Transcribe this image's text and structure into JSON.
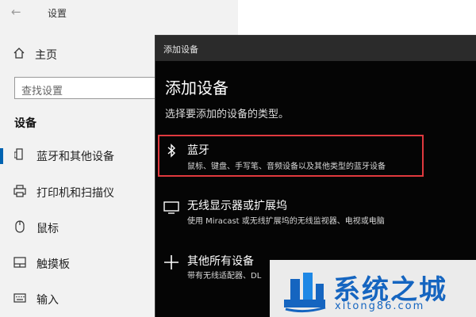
{
  "settings": {
    "title": "设置",
    "back_icon": "back-arrow-icon",
    "home_label": "主页",
    "search_placeholder": "查找设置",
    "section_title": "设备",
    "nav": [
      {
        "label": "蓝牙和其他设备",
        "icon": "bluetooth-devices-icon",
        "selected": true
      },
      {
        "label": "打印机和扫描仪",
        "icon": "printer-icon",
        "selected": false
      },
      {
        "label": "鼠标",
        "icon": "mouse-icon",
        "selected": false
      },
      {
        "label": "触摸板",
        "icon": "touchpad-icon",
        "selected": false
      },
      {
        "label": "输入",
        "icon": "keyboard-icon",
        "selected": false
      }
    ]
  },
  "dialog": {
    "window_title": "添加设备",
    "heading": "添加设备",
    "subtitle": "选择要添加的设备的类型。",
    "options": [
      {
        "name": "蓝牙",
        "desc": "鼠标、键盘、手写笔、音频设备以及其他类型的蓝牙设备",
        "icon": "bluetooth-icon",
        "highlighted": true
      },
      {
        "name": "无线显示器或扩展坞",
        "desc": "使用 Miracast 或无线扩展坞的无线监视器、电视或电脑",
        "icon": "monitor-icon",
        "highlighted": false
      },
      {
        "name": "其他所有设备",
        "desc": "带有无线适配器、DL",
        "icon": "plus-icon",
        "highlighted": false
      }
    ]
  },
  "watermark": {
    "name": "系统之城",
    "url": "xitong86.com"
  },
  "colors": {
    "accent": "#0063b1",
    "highlight_border": "#e0393e",
    "dialog_bg": "#050505",
    "watermark": "#1565c0"
  }
}
